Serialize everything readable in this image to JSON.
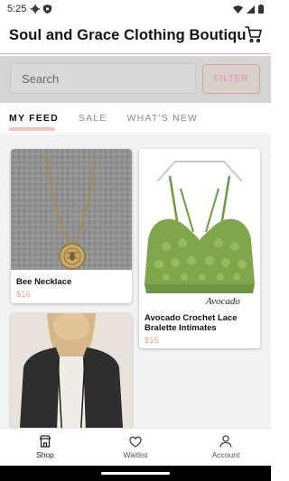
{
  "status_bar": {
    "time": "5:25"
  },
  "header": {
    "title": "Soul and Grace Clothing Boutique"
  },
  "search": {
    "placeholder": "Search",
    "filter_label": "FILTER"
  },
  "tabs": [
    {
      "label": "MY FEED",
      "active": true
    },
    {
      "label": "SALE",
      "active": false
    },
    {
      "label": "WHAT'S NEW",
      "active": false
    }
  ],
  "products": [
    {
      "name": "Bee Necklace",
      "price": "$16"
    },
    {
      "name": "Avocado Crochet Lace Bralette Intimates",
      "price": "$15",
      "image_caption": "Avocado"
    }
  ],
  "bottom_nav": [
    {
      "label": "Shop",
      "icon": "store-icon",
      "active": true
    },
    {
      "label": "Waitlist",
      "icon": "heart-icon",
      "active": false
    },
    {
      "label": "Account",
      "icon": "person-icon",
      "active": false
    }
  ],
  "colors": {
    "accent": "#e8a092",
    "search_band": "#d5d5d5"
  }
}
